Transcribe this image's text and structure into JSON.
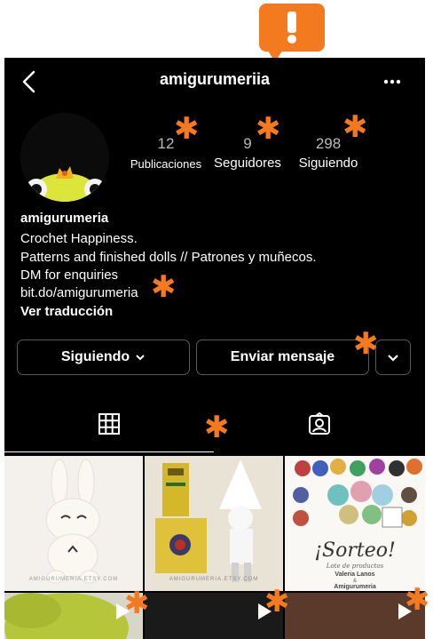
{
  "header": {
    "username": "amigurumeriia"
  },
  "profile": {
    "stats": [
      {
        "value": "12",
        "label": "Publicaciones"
      },
      {
        "value": "9",
        "label": "Seguidores"
      },
      {
        "value": "298",
        "label": "Siguiendo"
      }
    ],
    "name": "amigurumeria",
    "bio_lines": [
      "Crochet Happiness.",
      "Patterns and finished dolls // Patrones y muñecos.",
      "DM for enquiries",
      "bit.do/amigurumeria"
    ],
    "translate_label": "Ver traducción"
  },
  "actions": {
    "following_label": "Siguiendo",
    "message_label": "Enviar mensaje"
  },
  "grid": {
    "watermark": "AMIGURUMERIA.ETSY.COM",
    "sorteo_title": "¡Sorteo!",
    "sorteo_sub": "Lote de productos",
    "sorteo_names": [
      "Valeria Lanos",
      "&",
      "Amigurumeria"
    ]
  },
  "icons": [
    "back-icon",
    "more-icon",
    "alert-icon",
    "chevron-down-icon",
    "grid-icon",
    "tagged-icon",
    "play-icon"
  ],
  "colors": {
    "accent": "#f47a20",
    "background": "#000000",
    "text": "#ffffff"
  }
}
